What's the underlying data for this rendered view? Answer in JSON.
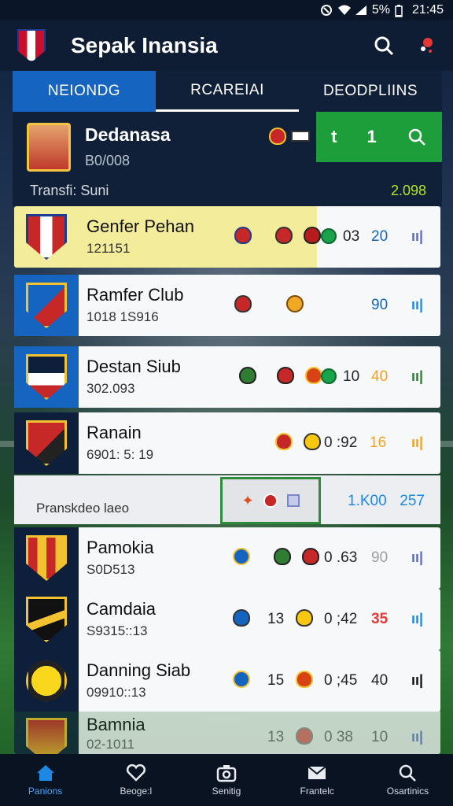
{
  "status_bar": {
    "battery": "5%",
    "time": "21:45"
  },
  "app": {
    "title": "Sepak Inansia"
  },
  "tabs": [
    {
      "label": "NEIONDG"
    },
    {
      "label": "RCAREIAI"
    },
    {
      "label": "DEODPLIINS"
    }
  ],
  "header": {
    "name": "Dedanasa",
    "sub": "B0/008",
    "stat_left": "t",
    "stat_right": "1",
    "transfer_label": "Transfi: Suni",
    "transfer_value": "2.098"
  },
  "rows": [
    {
      "name": "Genfer Pehan",
      "code": "121151",
      "score": "03",
      "value": "20",
      "icon": "ıı|"
    },
    {
      "name": "Ramfer Club",
      "code": "1018 1S916",
      "score": "",
      "value": "90",
      "icon": "ıı|"
    },
    {
      "name": "Destan Siub",
      "code": "302.093",
      "score": "10",
      "value": "40",
      "icon": "ıı|"
    },
    {
      "name": "Ranain",
      "code": "6901: 5: 19",
      "score": "0 :92",
      "value": "16",
      "icon": "ıı|"
    }
  ],
  "divider": {
    "label": "Pranskdeo laeo",
    "value_left": "1.K00",
    "value_right": "257"
  },
  "rows2": [
    {
      "name": "Pamokia",
      "code": "S0D513",
      "score": "0 .63",
      "value": "90",
      "icon": "ıı|"
    },
    {
      "name": "Camdaia",
      "code": "S9315::13",
      "mid": "13",
      "score": "0 ;42",
      "value": "35",
      "icon": "ıı|"
    },
    {
      "name": "Danning Siab",
      "code": "09910::13",
      "mid": "15",
      "score": "0 ;45",
      "value": "40",
      "icon": "ıı|"
    },
    {
      "name": "Bamnia",
      "code": "02-1011",
      "mid": "13",
      "score": "0 38",
      "value": "10",
      "icon": "ıı|"
    }
  ],
  "bottom_nav": [
    {
      "label": "Panions",
      "icon": "home-icon"
    },
    {
      "label": "Beoge:l",
      "icon": "heart-icon"
    },
    {
      "label": "Senitig",
      "icon": "camera-icon"
    },
    {
      "label": "Frantelc",
      "icon": "inbox-icon"
    },
    {
      "label": "Osartinics",
      "icon": "search-icon"
    }
  ],
  "colors": {
    "accent_blue": "#1565c0",
    "accent_green": "#1e9e3a",
    "highlight_yellow": "#f3ec9a",
    "value_red": "#e53935",
    "value_orange": "#f4a11a"
  }
}
